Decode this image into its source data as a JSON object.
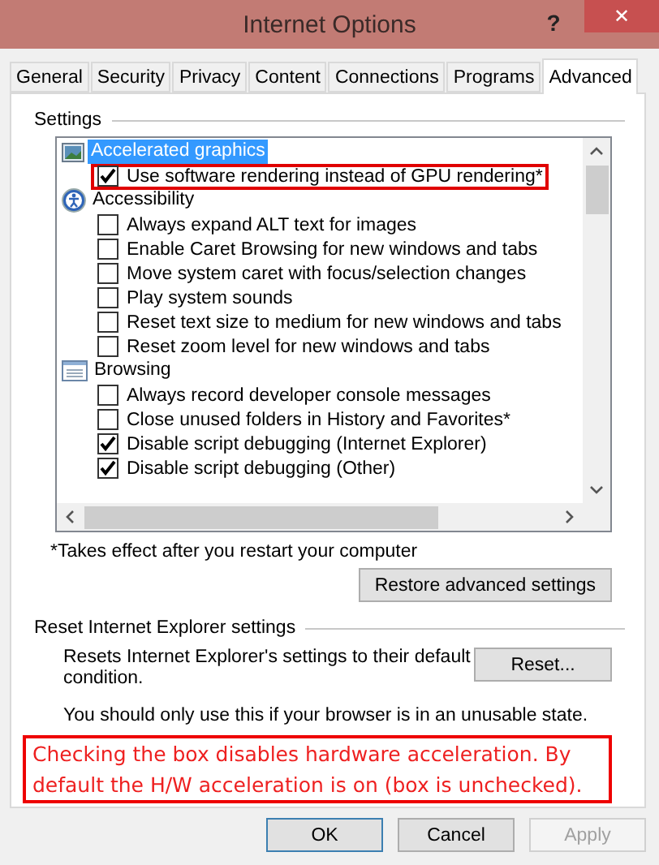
{
  "window": {
    "title": "Internet Options",
    "help": "?",
    "close": "✕"
  },
  "tabs": [
    {
      "label": "General",
      "selected": false
    },
    {
      "label": "Security",
      "selected": false
    },
    {
      "label": "Privacy",
      "selected": false
    },
    {
      "label": "Content",
      "selected": false
    },
    {
      "label": "Connections",
      "selected": false
    },
    {
      "label": "Programs",
      "selected": false
    },
    {
      "label": "Advanced",
      "selected": true
    }
  ],
  "settings": {
    "title": "Settings",
    "groups": [
      {
        "label": "Accelerated graphics",
        "selected": true,
        "children": [
          {
            "label": "Use software rendering instead of GPU rendering*",
            "checked": true,
            "annotated": true
          }
        ]
      },
      {
        "label": "Accessibility",
        "selected": false,
        "children": [
          {
            "label": "Always expand ALT text for images",
            "checked": false,
            "annotated": false
          },
          {
            "label": "Enable Caret Browsing for new windows and tabs",
            "checked": false,
            "annotated": false
          },
          {
            "label": "Move system caret with focus/selection changes",
            "checked": false,
            "annotated": false
          },
          {
            "label": "Play system sounds",
            "checked": false,
            "annotated": false
          },
          {
            "label": "Reset text size to medium for new windows and tabs",
            "checked": false,
            "annotated": false
          },
          {
            "label": "Reset zoom level for new windows and tabs",
            "checked": false,
            "annotated": false
          }
        ]
      },
      {
        "label": "Browsing",
        "selected": false,
        "children": [
          {
            "label": "Always record developer console messages",
            "checked": false,
            "annotated": false
          },
          {
            "label": "Close unused folders in History and Favorites*",
            "checked": false,
            "annotated": false
          },
          {
            "label": "Disable script debugging (Internet Explorer)",
            "checked": true,
            "annotated": false
          },
          {
            "label": "Disable script debugging (Other)",
            "checked": true,
            "annotated": false
          }
        ]
      }
    ],
    "footnote": "*Takes effect after you restart your computer",
    "restore_button": "Restore advanced settings"
  },
  "reset": {
    "title": "Reset Internet Explorer settings",
    "description": "Resets Internet Explorer's settings to their default condition.",
    "button": "Reset...",
    "warning": "You should only use this if your browser is in an unusable state."
  },
  "annotation": "Checking the box disables hardware acceleration. By default the H/W acceleration is on (box is unchecked).",
  "buttons": [
    {
      "label": "OK",
      "disabled": false,
      "default": true
    },
    {
      "label": "Cancel",
      "disabled": false,
      "default": false
    },
    {
      "label": "Apply",
      "disabled": true,
      "default": false
    }
  ]
}
